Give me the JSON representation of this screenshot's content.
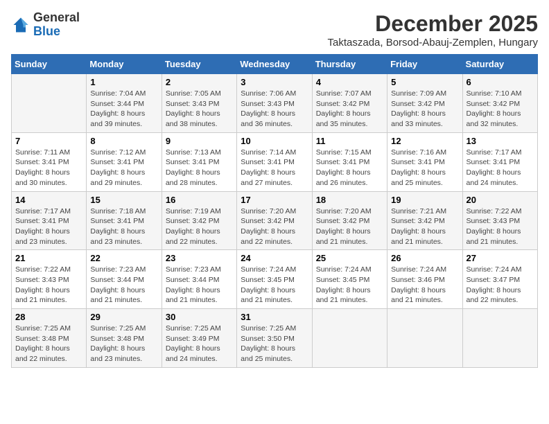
{
  "logo": {
    "general": "General",
    "blue": "Blue"
  },
  "title": {
    "month_year": "December 2025",
    "location": "Taktaszada, Borsod-Abauj-Zemplen, Hungary"
  },
  "headers": [
    "Sunday",
    "Monday",
    "Tuesday",
    "Wednesday",
    "Thursday",
    "Friday",
    "Saturday"
  ],
  "weeks": [
    [
      {
        "day": "",
        "sunrise": "",
        "sunset": "",
        "daylight": ""
      },
      {
        "day": "1",
        "sunrise": "Sunrise: 7:04 AM",
        "sunset": "Sunset: 3:44 PM",
        "daylight": "Daylight: 8 hours and 39 minutes."
      },
      {
        "day": "2",
        "sunrise": "Sunrise: 7:05 AM",
        "sunset": "Sunset: 3:43 PM",
        "daylight": "Daylight: 8 hours and 38 minutes."
      },
      {
        "day": "3",
        "sunrise": "Sunrise: 7:06 AM",
        "sunset": "Sunset: 3:43 PM",
        "daylight": "Daylight: 8 hours and 36 minutes."
      },
      {
        "day": "4",
        "sunrise": "Sunrise: 7:07 AM",
        "sunset": "Sunset: 3:42 PM",
        "daylight": "Daylight: 8 hours and 35 minutes."
      },
      {
        "day": "5",
        "sunrise": "Sunrise: 7:09 AM",
        "sunset": "Sunset: 3:42 PM",
        "daylight": "Daylight: 8 hours and 33 minutes."
      },
      {
        "day": "6",
        "sunrise": "Sunrise: 7:10 AM",
        "sunset": "Sunset: 3:42 PM",
        "daylight": "Daylight: 8 hours and 32 minutes."
      }
    ],
    [
      {
        "day": "7",
        "sunrise": "Sunrise: 7:11 AM",
        "sunset": "Sunset: 3:41 PM",
        "daylight": "Daylight: 8 hours and 30 minutes."
      },
      {
        "day": "8",
        "sunrise": "Sunrise: 7:12 AM",
        "sunset": "Sunset: 3:41 PM",
        "daylight": "Daylight: 8 hours and 29 minutes."
      },
      {
        "day": "9",
        "sunrise": "Sunrise: 7:13 AM",
        "sunset": "Sunset: 3:41 PM",
        "daylight": "Daylight: 8 hours and 28 minutes."
      },
      {
        "day": "10",
        "sunrise": "Sunrise: 7:14 AM",
        "sunset": "Sunset: 3:41 PM",
        "daylight": "Daylight: 8 hours and 27 minutes."
      },
      {
        "day": "11",
        "sunrise": "Sunrise: 7:15 AM",
        "sunset": "Sunset: 3:41 PM",
        "daylight": "Daylight: 8 hours and 26 minutes."
      },
      {
        "day": "12",
        "sunrise": "Sunrise: 7:16 AM",
        "sunset": "Sunset: 3:41 PM",
        "daylight": "Daylight: 8 hours and 25 minutes."
      },
      {
        "day": "13",
        "sunrise": "Sunrise: 7:17 AM",
        "sunset": "Sunset: 3:41 PM",
        "daylight": "Daylight: 8 hours and 24 minutes."
      }
    ],
    [
      {
        "day": "14",
        "sunrise": "Sunrise: 7:17 AM",
        "sunset": "Sunset: 3:41 PM",
        "daylight": "Daylight: 8 hours and 23 minutes."
      },
      {
        "day": "15",
        "sunrise": "Sunrise: 7:18 AM",
        "sunset": "Sunset: 3:41 PM",
        "daylight": "Daylight: 8 hours and 23 minutes."
      },
      {
        "day": "16",
        "sunrise": "Sunrise: 7:19 AM",
        "sunset": "Sunset: 3:42 PM",
        "daylight": "Daylight: 8 hours and 22 minutes."
      },
      {
        "day": "17",
        "sunrise": "Sunrise: 7:20 AM",
        "sunset": "Sunset: 3:42 PM",
        "daylight": "Daylight: 8 hours and 22 minutes."
      },
      {
        "day": "18",
        "sunrise": "Sunrise: 7:20 AM",
        "sunset": "Sunset: 3:42 PM",
        "daylight": "Daylight: 8 hours and 21 minutes."
      },
      {
        "day": "19",
        "sunrise": "Sunrise: 7:21 AM",
        "sunset": "Sunset: 3:42 PM",
        "daylight": "Daylight: 8 hours and 21 minutes."
      },
      {
        "day": "20",
        "sunrise": "Sunrise: 7:22 AM",
        "sunset": "Sunset: 3:43 PM",
        "daylight": "Daylight: 8 hours and 21 minutes."
      }
    ],
    [
      {
        "day": "21",
        "sunrise": "Sunrise: 7:22 AM",
        "sunset": "Sunset: 3:43 PM",
        "daylight": "Daylight: 8 hours and 21 minutes."
      },
      {
        "day": "22",
        "sunrise": "Sunrise: 7:23 AM",
        "sunset": "Sunset: 3:44 PM",
        "daylight": "Daylight: 8 hours and 21 minutes."
      },
      {
        "day": "23",
        "sunrise": "Sunrise: 7:23 AM",
        "sunset": "Sunset: 3:44 PM",
        "daylight": "Daylight: 8 hours and 21 minutes."
      },
      {
        "day": "24",
        "sunrise": "Sunrise: 7:24 AM",
        "sunset": "Sunset: 3:45 PM",
        "daylight": "Daylight: 8 hours and 21 minutes."
      },
      {
        "day": "25",
        "sunrise": "Sunrise: 7:24 AM",
        "sunset": "Sunset: 3:45 PM",
        "daylight": "Daylight: 8 hours and 21 minutes."
      },
      {
        "day": "26",
        "sunrise": "Sunrise: 7:24 AM",
        "sunset": "Sunset: 3:46 PM",
        "daylight": "Daylight: 8 hours and 21 minutes."
      },
      {
        "day": "27",
        "sunrise": "Sunrise: 7:24 AM",
        "sunset": "Sunset: 3:47 PM",
        "daylight": "Daylight: 8 hours and 22 minutes."
      }
    ],
    [
      {
        "day": "28",
        "sunrise": "Sunrise: 7:25 AM",
        "sunset": "Sunset: 3:48 PM",
        "daylight": "Daylight: 8 hours and 22 minutes."
      },
      {
        "day": "29",
        "sunrise": "Sunrise: 7:25 AM",
        "sunset": "Sunset: 3:48 PM",
        "daylight": "Daylight: 8 hours and 23 minutes."
      },
      {
        "day": "30",
        "sunrise": "Sunrise: 7:25 AM",
        "sunset": "Sunset: 3:49 PM",
        "daylight": "Daylight: 8 hours and 24 minutes."
      },
      {
        "day": "31",
        "sunrise": "Sunrise: 7:25 AM",
        "sunset": "Sunset: 3:50 PM",
        "daylight": "Daylight: 8 hours and 25 minutes."
      },
      {
        "day": "",
        "sunrise": "",
        "sunset": "",
        "daylight": ""
      },
      {
        "day": "",
        "sunrise": "",
        "sunset": "",
        "daylight": ""
      },
      {
        "day": "",
        "sunrise": "",
        "sunset": "",
        "daylight": ""
      }
    ]
  ]
}
